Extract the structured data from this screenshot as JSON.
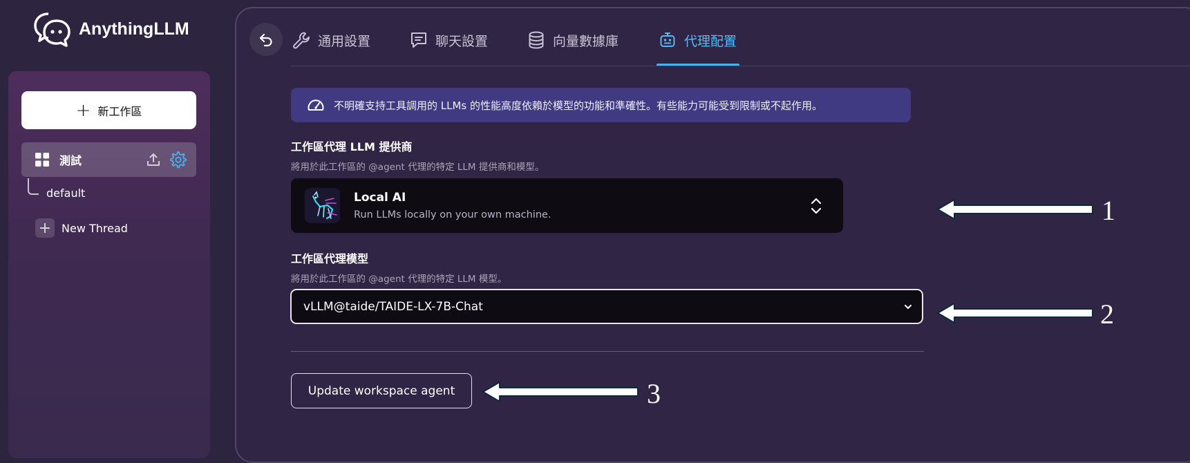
{
  "app": {
    "name": "AnythingLLM"
  },
  "sidebar": {
    "new_workspace_label": "新工作區",
    "workspace": {
      "name": "測試"
    },
    "threads": [
      {
        "label": "default"
      }
    ],
    "new_thread_label": "New Thread"
  },
  "tabs": [
    {
      "label": "通用設置",
      "icon": "wrench-icon"
    },
    {
      "label": "聊天設置",
      "icon": "chat-icon"
    },
    {
      "label": "向量數據庫",
      "icon": "database-icon"
    },
    {
      "label": "代理配置",
      "icon": "robot-icon",
      "active": true
    }
  ],
  "banner": {
    "text": "不明確支持工具調用的 LLMs 的性能高度依賴於模型的功能和準確性。有些能力可能受到限制或不起作用。"
  },
  "provider_section": {
    "title": "工作區代理 LLM 提供商",
    "subtitle": "將用於此工作區的 @agent 代理的特定 LLM 提供商和模型。",
    "selected": {
      "name": "Local AI",
      "description": "Run LLMs locally on your own machine."
    }
  },
  "model_section": {
    "title": "工作區代理模型",
    "subtitle": "將用於此工作區的 @agent 代理的特定 LLM 模型。",
    "selected_value": "vLLM@taide/TAIDE-LX-7B-Chat"
  },
  "update_button_label": "Update workspace agent",
  "callouts": [
    {
      "number": "1"
    },
    {
      "number": "2"
    },
    {
      "number": "3"
    }
  ],
  "colors": {
    "accent": "#4ab0f0",
    "background": "#2d2440",
    "banner": "#3f3a82"
  }
}
